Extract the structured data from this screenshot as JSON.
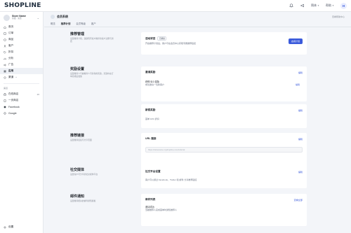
{
  "topbar": {
    "logo": "SHOPLINE",
    "lang_label": "简体",
    "help_label": "帮助",
    "avatar_letter": "H"
  },
  "sidebar": {
    "store_name": "Store Name",
    "store_plan": "基础 · 免费",
    "items": [
      {
        "label": "首页",
        "icon": "home-icon"
      },
      {
        "label": "订单",
        "icon": "orders-icon"
      },
      {
        "label": "商品",
        "icon": "products-icon"
      },
      {
        "label": "客户",
        "icon": "customers-icon"
      },
      {
        "label": "折扣",
        "icon": "discount-icon"
      },
      {
        "label": "分析",
        "icon": "analytics-icon"
      },
      {
        "label": "广告",
        "icon": "ads-icon"
      },
      {
        "label": "应用",
        "icon": "apps-icon"
      },
      {
        "label": "渠道",
        "icon": "channels-icon",
        "badge": "+"
      }
    ],
    "group_label": "渠道",
    "channels": [
      {
        "label": "在线商店",
        "icon": "store-icon",
        "count": "26"
      },
      {
        "label": "一页商店",
        "icon": "page-icon"
      },
      {
        "label": "Facebook",
        "icon": "facebook-icon"
      },
      {
        "label": "Google",
        "icon": "google-icon"
      }
    ],
    "settings_label": "设置"
  },
  "main": {
    "page_title": "会员系统",
    "page_link": "查看帮助中心",
    "tabs": [
      "概览",
      "推荐计划",
      "会员等级",
      "客户"
    ],
    "active_tab": 1
  },
  "sections": {
    "referral": {
      "title": "推荐管理",
      "desc": "设置推荐计划，鼓励现有客户推荐新客户注册与消费",
      "card_title": "活动状态",
      "card_tag": "已停用",
      "card_text": "开启推荐计划后，客户可在会员中心获取专属推荐链接",
      "button": "启用计划"
    },
    "reward": {
      "title": "奖励设置",
      "desc": "设置推荐人与被推荐人可获得的奖励，奖励将在订单完成后发放",
      "card1_title": "邀请奖励",
      "card1_link": "编辑",
      "card1_sub": "获得 $10 奖励",
      "card1_text": "成功邀请一位新客户",
      "card1_action": "编辑",
      "card2_title": "新客奖励",
      "card2_link": "编辑",
      "card2_sub": "首单 10% 折扣"
    },
    "link": {
      "title": "推荐链接",
      "desc": "设置推荐链接与分享页面",
      "card_title": "URL 链接",
      "card_link": "编辑",
      "url_placeholder": "https://storename.myshopline.com/referral"
    },
    "social": {
      "title": "社交媒体",
      "desc": "设置客户可分享的社交媒体平台",
      "card_title": "社交平台设置",
      "card_link": "编辑",
      "card_text": "客户可以通过 Facebook、Twitter 和 邮件 分享推荐链接"
    },
    "email": {
      "title": "邮件通知",
      "desc": "设置推荐相关的邮件通知模板",
      "card_title": "邮件列表",
      "card_link": "查看全部",
      "card_sub": "邀请成功",
      "card_text": "当被推荐人完成首单时通知推荐人"
    }
  }
}
